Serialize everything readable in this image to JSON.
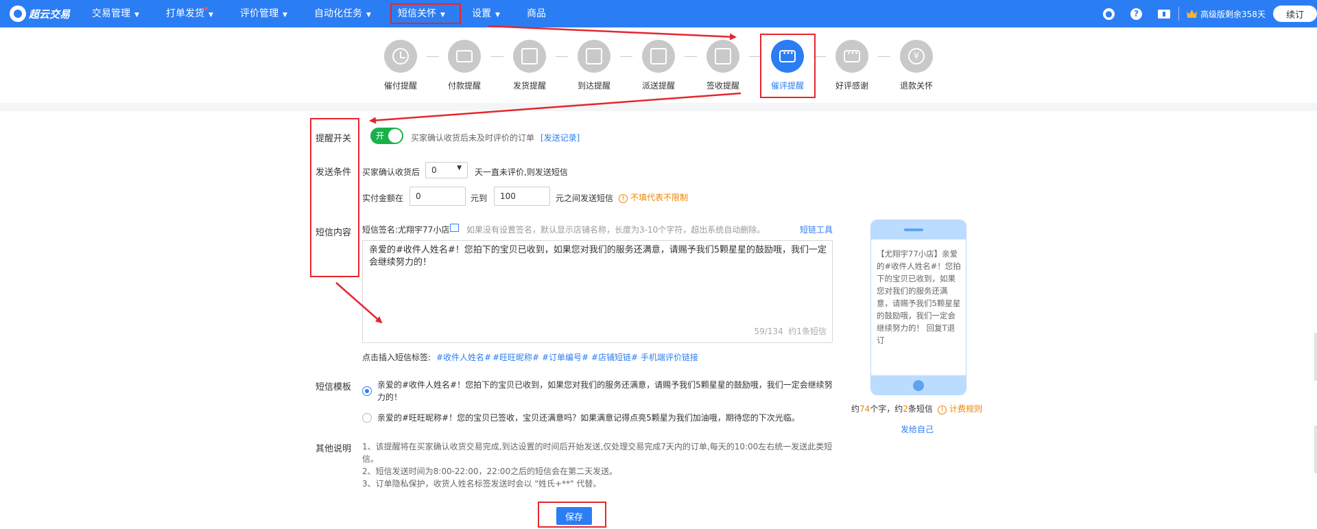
{
  "nav": {
    "logo": "超云交易",
    "items": [
      {
        "label": "交易管理",
        "caret": true
      },
      {
        "label": "打单发货",
        "caret": true,
        "dot": true
      },
      {
        "label": "评价管理",
        "caret": true
      },
      {
        "label": "自动化任务",
        "caret": true
      },
      {
        "label": "短信关怀",
        "caret": true
      },
      {
        "label": "设置",
        "caret": true
      },
      {
        "label": "商品",
        "caret": false
      }
    ],
    "help_icon": "?",
    "version_text": "高级版剩余358天",
    "renew_label": "续订"
  },
  "steps": [
    {
      "label": "催付提醒",
      "icon": "clock-icon"
    },
    {
      "label": "付款提醒",
      "icon": "card-icon"
    },
    {
      "label": "发货提醒",
      "icon": "ship-box-icon"
    },
    {
      "label": "到达提醒",
      "icon": "arrive-box-icon"
    },
    {
      "label": "派送提醒",
      "icon": "dispatch-icon"
    },
    {
      "label": "签收提醒",
      "icon": "sign-doc-icon"
    },
    {
      "label": "催评提醒",
      "icon": "chat-icon",
      "active": true
    },
    {
      "label": "好评感谢",
      "icon": "thanks-chat-icon"
    },
    {
      "label": "退款关怀",
      "icon": "yen-icon",
      "glyph": "¥"
    }
  ],
  "form": {
    "switch_label": "提醒开关",
    "switch_state": "开",
    "switch_desc": "买家确认收货后未及时评价的订单",
    "send_record_link": "[发送记录]",
    "condition_label": "发送条件",
    "cond1_prefix": "买家确认收货后",
    "cond1_value": "0",
    "cond1_suffix": "天一直未评价,则发送短信",
    "cond2_prefix": "实付金额在",
    "cond2_min": "0",
    "cond2_mid": "元到",
    "cond2_max": "100",
    "cond2_suffix": "元之间发送短信",
    "cond2_hint": "不填代表不限制",
    "content_label": "短信内容",
    "signature": "短信签名:尤翔宇77小店",
    "signature_hint": "如果没有设置签名，默认显示店铺名称，长度为3-10个字符，超出系统自动删除。",
    "link_tool": "短链工具",
    "content": "亲爱的#收件人姓名#！您拍下的宝贝已收到，如果您对我们的服务还满意，请赐予我们5颗星星的鼓励哦，我们一定会继续努力的！",
    "char_count": "59/134",
    "sms_count": "约1条短信",
    "insert_tags_label": "点击插入短信标签:",
    "tags": [
      "#收件人姓名#",
      "#旺旺昵称#",
      "#订单编号#",
      "#店铺短链#",
      "手机端评价链接"
    ],
    "template_label": "短信模板",
    "templates": [
      {
        "text": "亲爱的#收件人姓名#！您拍下的宝贝已收到，如果您对我们的服务还满意，请赐予我们5颗星星的鼓励哦，我们一定会继续努力的！",
        "checked": true
      },
      {
        "text": "亲爱的#旺旺昵称#！您的宝贝已签收，宝贝还满意吗？如果满意记得点亮5颗星为我们加油哦，期待您的下次光临。",
        "checked": false
      }
    ],
    "notes_label": "其他说明",
    "notes": [
      "1、该提醒将在买家确认收货交易完成,到达设置的时间后开始发送,仅处理交易完成7天内的订单,每天的10:00左右统一发送此类短信。",
      "2、短信发送时间为8:00-22:00，22:00之后的短信会在第二天发送。",
      "3、订单隐私保护，收货人姓名标签发送时会以 \"姓氏+**\" 代替。"
    ],
    "save_label": "保存"
  },
  "preview": {
    "text": "【尤翔宇77小店】亲爱的#收件人姓名#！您拍下的宝贝已收到，如果您对我们的服务还满意，请赐予我们5颗星星的鼓励哦，我们一定会继续努力的！ 回复T退订",
    "stat_prefix": "约",
    "char_num": "74",
    "stat_mid": "个字，约",
    "sms_num": "2",
    "stat_suffix": "条短信",
    "billing_rule": "计费规则",
    "send_self": "发给自己"
  },
  "colors": {
    "primary": "#2b7df4",
    "switch_on": "#19b14a",
    "annotation": "#e5262c",
    "warning": "#f08200"
  }
}
